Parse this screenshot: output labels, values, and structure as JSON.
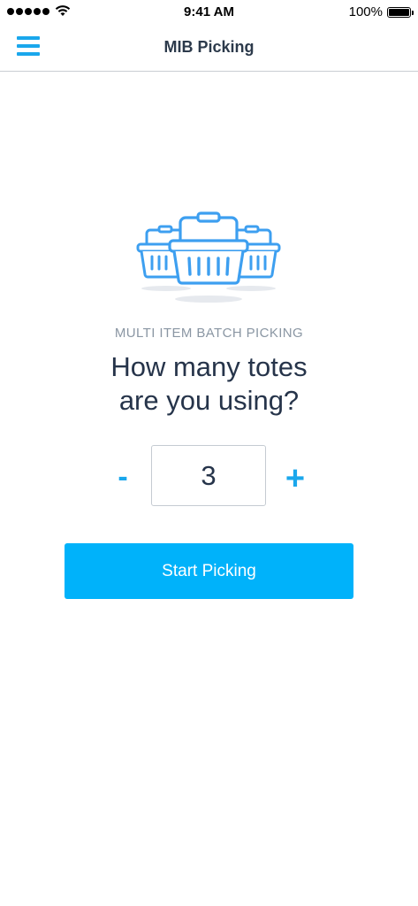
{
  "status_bar": {
    "time": "9:41 AM",
    "battery": "100%"
  },
  "nav": {
    "title": "MIB Picking",
    "menu_icon": "hamburger-menu-icon"
  },
  "illustration": {
    "icon": "totes-baskets-icon",
    "color": "#3d9ff0"
  },
  "prompt": {
    "subtitle": "MULTI ITEM BATCH PICKING",
    "headline_line1": "How many totes",
    "headline_line2": "are you using?"
  },
  "stepper": {
    "decrement_label": "-",
    "value": "3",
    "increment_label": "+"
  },
  "actions": {
    "start_label": "Start Picking"
  },
  "colors": {
    "accent": "#1aa7ec",
    "button_bg": "#00b2fa",
    "text_dark": "#26344a",
    "text_muted": "#8a96a3"
  }
}
